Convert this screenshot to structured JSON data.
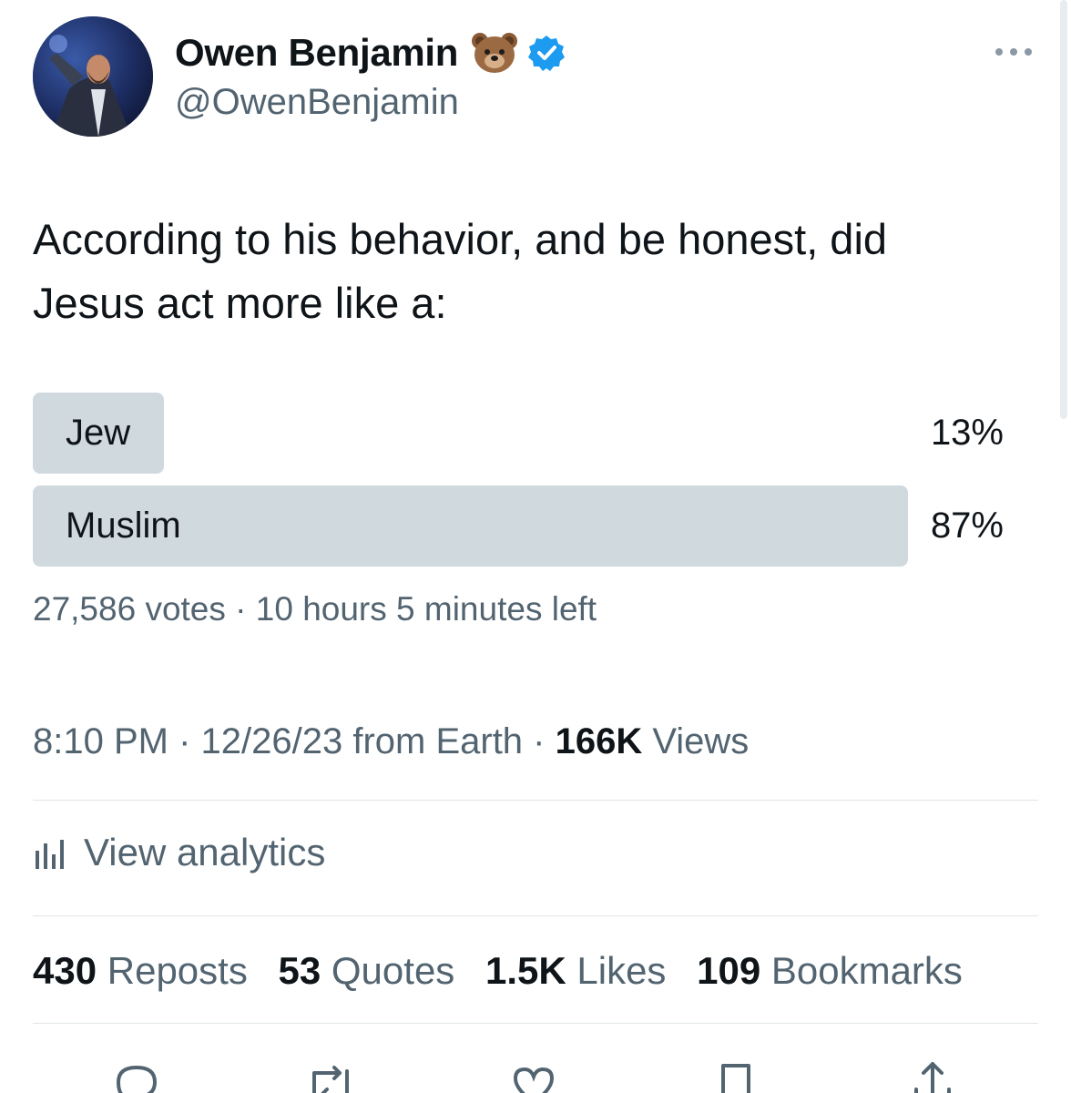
{
  "author": {
    "display_name": "Owen Benjamin",
    "handle": "@OwenBenjamin",
    "name_emoji": "bear-face-emoji",
    "verified": true,
    "verified_color": "#1d9bf0"
  },
  "tweet": {
    "text_line1": "According to his behavior, and be honest, did",
    "text_line2": "Jesus act more like a:"
  },
  "poll": {
    "options": [
      {
        "label": "Jew",
        "percent_text": "13%",
        "percent": 13
      },
      {
        "label": "Muslim",
        "percent_text": "87%",
        "percent": 87
      }
    ],
    "meta": "27,586 votes · 10 hours 5 minutes left",
    "bar_color": "#cfd9de"
  },
  "timestamp": {
    "prefix": "8:10 PM · 12/26/23 from Earth · ",
    "views_count": "166K",
    "views_label": " Views"
  },
  "analytics": {
    "label": "View analytics"
  },
  "stats": [
    {
      "num": "430",
      "label": "Reposts"
    },
    {
      "num": "53",
      "label": "Quotes"
    },
    {
      "num": "1.5K",
      "label": "Likes"
    },
    {
      "num": "109",
      "label": "Bookmarks"
    }
  ],
  "actions": [
    "reply-icon",
    "repost-icon",
    "like-icon",
    "bookmark-icon",
    "share-icon"
  ],
  "colors": {
    "text": "#0f1419",
    "secondary": "#536471",
    "divider": "#e1e6ea"
  }
}
